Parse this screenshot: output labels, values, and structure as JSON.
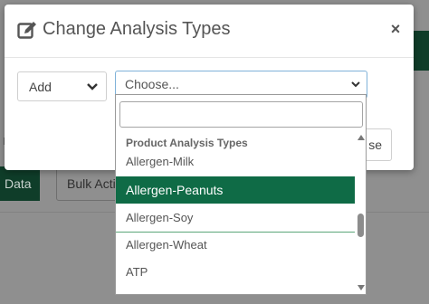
{
  "modal": {
    "title": "Change Analysis Types",
    "title_icon": "edit-icon",
    "close_label": "×",
    "mode_select": {
      "value": "Add",
      "icon": "chevron-down-icon"
    },
    "type_select": {
      "value": "Choose...",
      "icon": "chevron-down-icon"
    },
    "footer_button_partial": "se"
  },
  "dropdown": {
    "search_value": "",
    "group_label": "Product Analysis Types",
    "options": [
      {
        "label": "Allergen-Milk",
        "selected": false
      },
      {
        "label": "Allergen-Peanuts",
        "selected": true
      },
      {
        "label": "Allergen-Soy",
        "selected": false
      },
      {
        "label": "Allergen-Wheat",
        "selected": false
      },
      {
        "label": "ATP",
        "selected": false
      }
    ]
  },
  "background": {
    "data_button": "Data",
    "bulk_button": "Bulk Acti"
  },
  "colors": {
    "brand_green": "#0f6b46",
    "dark_green": "#0f3d29",
    "focus_border": "#7fb2d9"
  }
}
